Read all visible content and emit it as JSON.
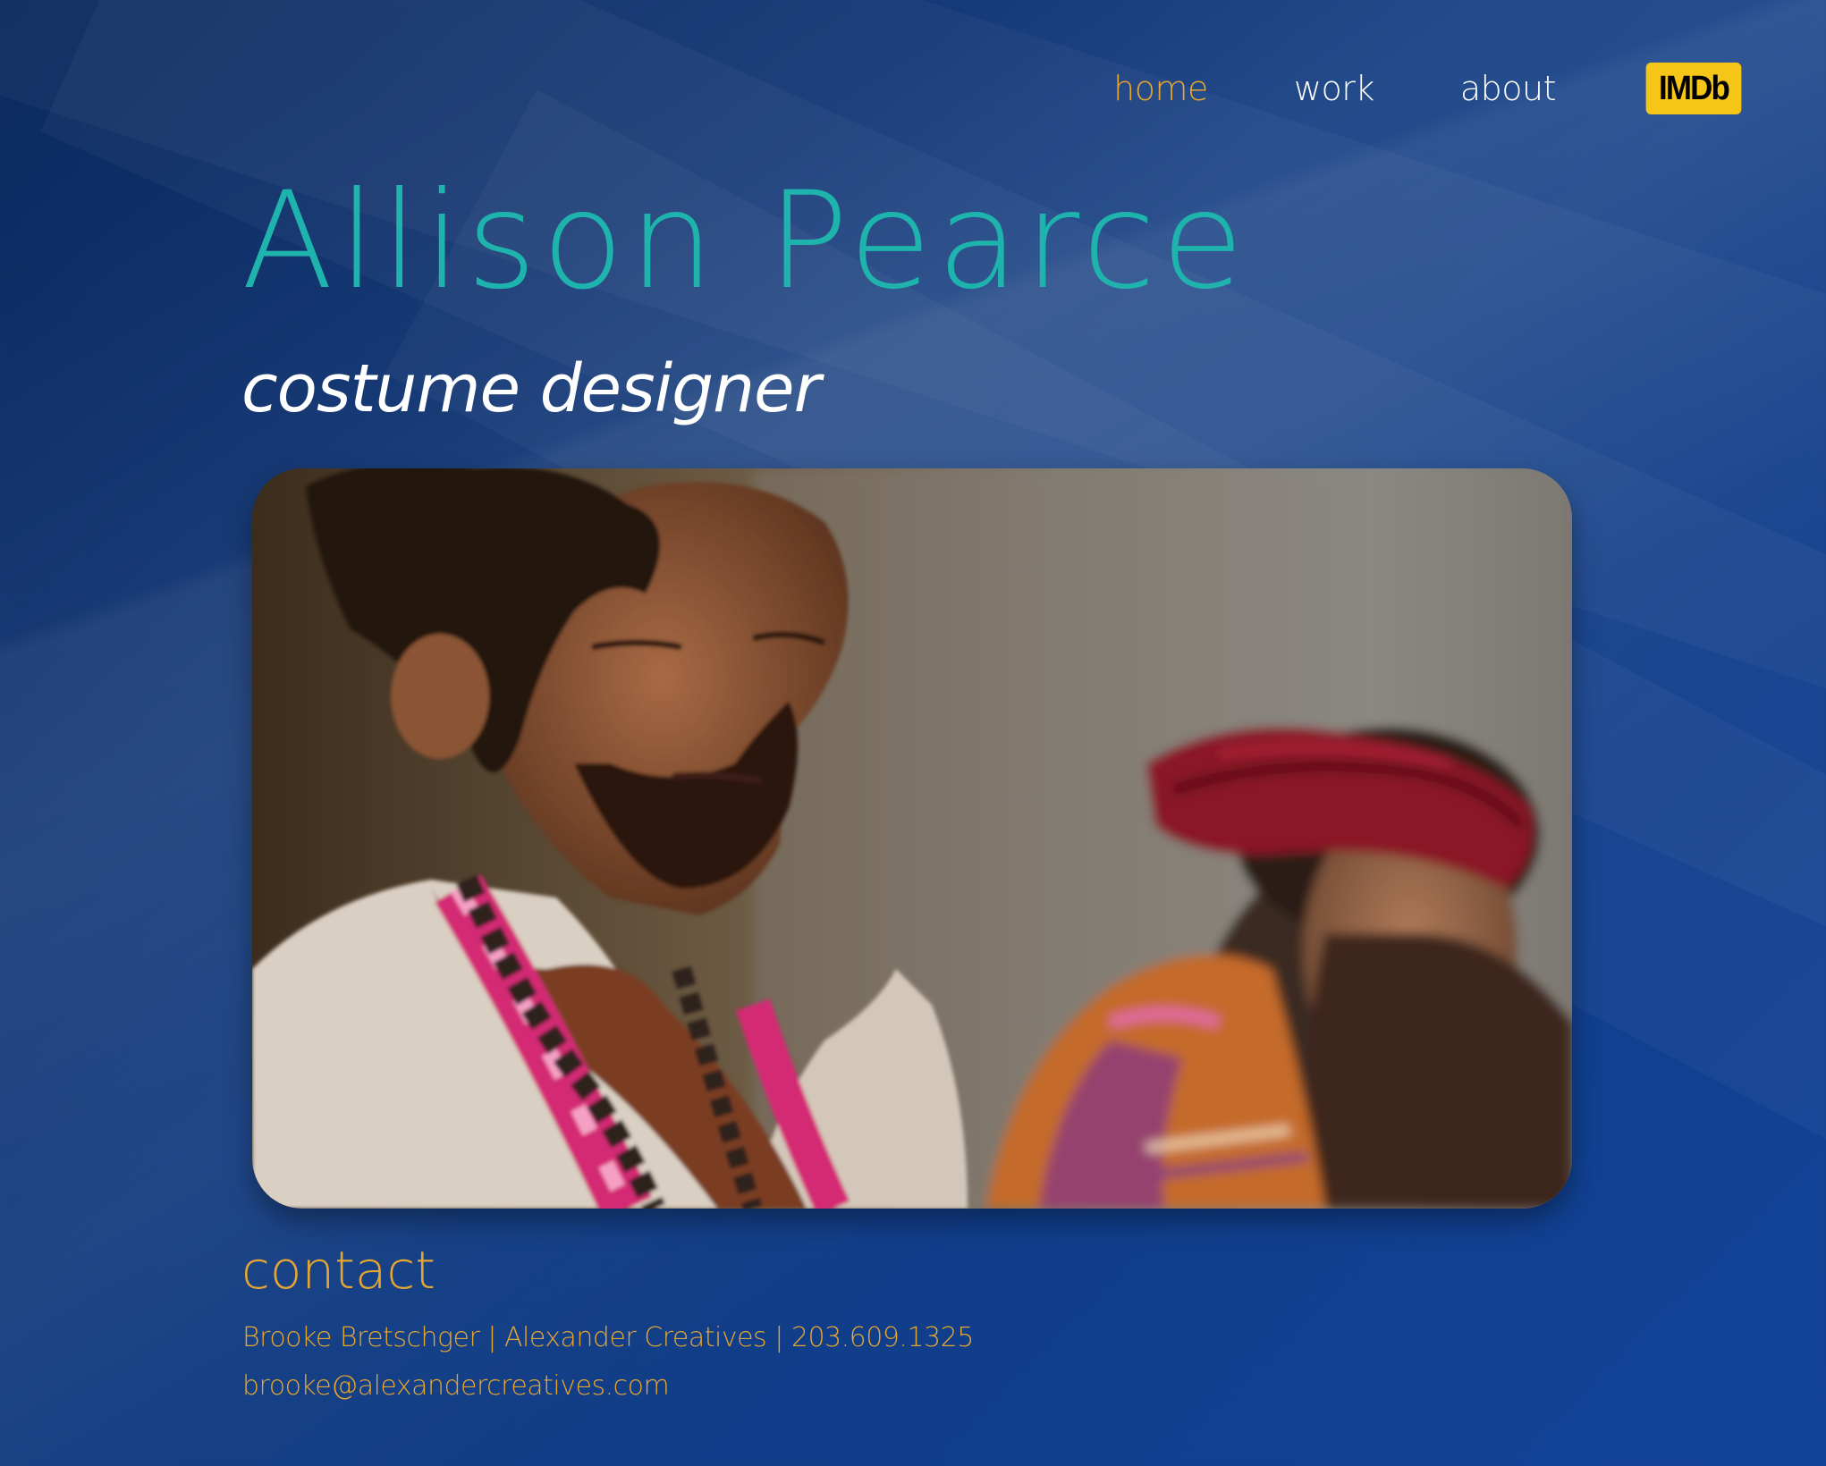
{
  "nav": {
    "items": [
      {
        "label": "home",
        "active": true
      },
      {
        "label": "work",
        "active": false
      },
      {
        "label": "about",
        "active": false
      }
    ],
    "imdb_label": "IMDb"
  },
  "header": {
    "name": "Allison Pearce",
    "role": "costume designer"
  },
  "contact": {
    "heading": "contact",
    "agent_line": "Brooke Bretschger | Alexander Creatives | 203.609.1325",
    "email": "brooke@alexandercreatives.com"
  },
  "colors": {
    "accent_gold": "#e5a631",
    "name_teal": "#1eb3ad",
    "imdb_yellow": "#f5c518",
    "background": "#0f3a80"
  }
}
